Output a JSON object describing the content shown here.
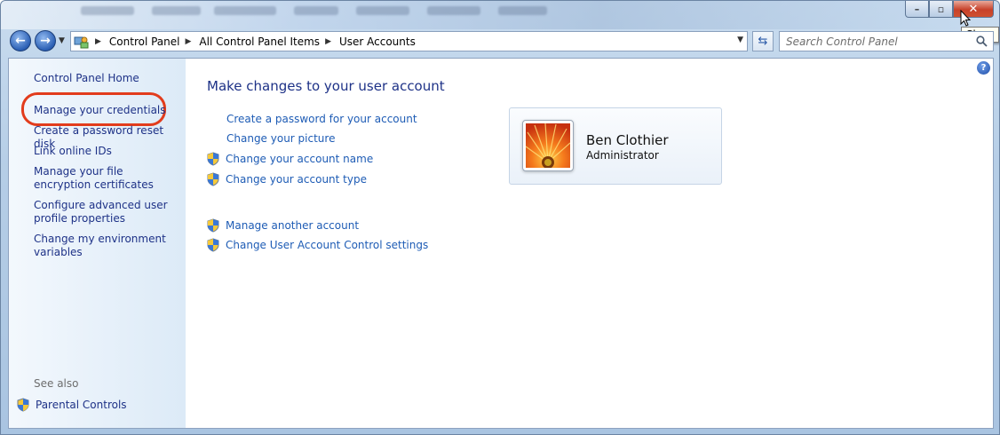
{
  "window": {
    "caption": {
      "minimize": "–",
      "maximize": "▫",
      "close": "✕"
    },
    "tooltip": "Close"
  },
  "address_bar": {
    "breadcrumbs": [
      "Control Panel",
      "All Control Panel Items",
      "User Accounts"
    ],
    "search_placeholder": "Search Control Panel"
  },
  "sidebar": {
    "items": [
      {
        "label": "Control Panel Home"
      },
      {
        "label": "Manage your credentials"
      },
      {
        "label": "Create a password reset disk"
      },
      {
        "label": "Link online IDs"
      },
      {
        "label": "Manage your file encryption certificates"
      },
      {
        "label": "Configure advanced user profile properties"
      },
      {
        "label": "Change my environment variables"
      }
    ],
    "see_also_label": "See also",
    "see_also_items": [
      {
        "label": "Parental Controls"
      }
    ]
  },
  "main": {
    "title": "Make changes to your user account",
    "tasks": [
      {
        "label": "Create a password for your account",
        "shield": false
      },
      {
        "label": "Change your picture",
        "shield": false
      },
      {
        "label": "Change your account name",
        "shield": true
      },
      {
        "label": "Change your account type",
        "shield": true
      }
    ],
    "other_tasks": [
      {
        "label": "Manage another account",
        "shield": true
      },
      {
        "label": "Change User Account Control settings",
        "shield": true
      }
    ],
    "user": {
      "name": "Ben Clothier",
      "role": "Administrator"
    }
  },
  "colors": {
    "link": "#1e5cb5",
    "nav_link": "#1e3287",
    "highlight": "#e23c1c"
  }
}
